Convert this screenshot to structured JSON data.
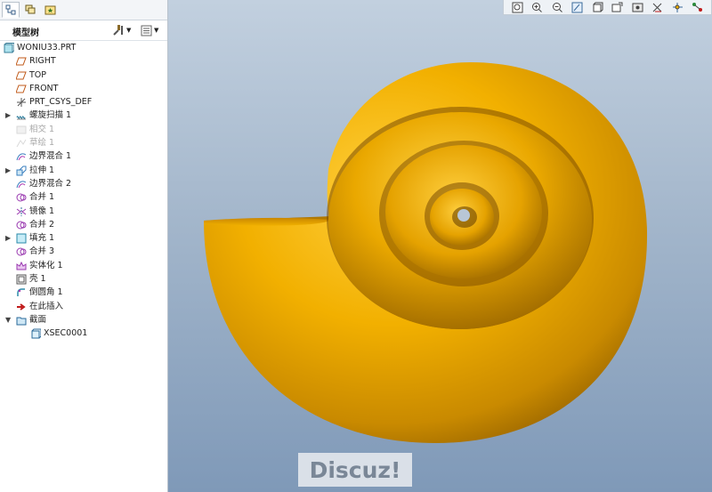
{
  "panel_tabs": [
    "model-tree-tab-icon",
    "layers-tab-icon",
    "favorites-tab-icon"
  ],
  "tree": {
    "title": "模型树",
    "items": [
      {
        "label": "WONIU33.PRT",
        "icon": "part-icon",
        "level": 0,
        "expand": ""
      },
      {
        "label": "RIGHT",
        "icon": "datum-plane-icon",
        "level": 1,
        "expand": ""
      },
      {
        "label": "TOP",
        "icon": "datum-plane-icon",
        "level": 1,
        "expand": ""
      },
      {
        "label": "FRONT",
        "icon": "datum-plane-icon",
        "level": 1,
        "expand": ""
      },
      {
        "label": "PRT_CSYS_DEF",
        "icon": "csys-icon",
        "level": 1,
        "expand": ""
      },
      {
        "label": "螺旋扫描 1",
        "icon": "helical-sweep-icon",
        "level": 1,
        "expand": "▶"
      },
      {
        "label": "相交 1",
        "icon": "intersect-icon",
        "level": 1,
        "expand": "",
        "dim": true
      },
      {
        "label": "草绘 1",
        "icon": "sketch-icon",
        "level": 1,
        "expand": "",
        "dim": true
      },
      {
        "label": "边界混合 1",
        "icon": "boundary-blend-icon",
        "level": 1,
        "expand": ""
      },
      {
        "label": "拉伸 1",
        "icon": "extrude-icon",
        "level": 1,
        "expand": "▶"
      },
      {
        "label": "边界混合 2",
        "icon": "boundary-blend-icon",
        "level": 1,
        "expand": ""
      },
      {
        "label": "合并 1",
        "icon": "merge-icon",
        "level": 1,
        "expand": ""
      },
      {
        "label": "镜像 1",
        "icon": "mirror-icon",
        "level": 1,
        "expand": ""
      },
      {
        "label": "合并 2",
        "icon": "merge-icon",
        "level": 1,
        "expand": ""
      },
      {
        "label": "填充 1",
        "icon": "fill-icon",
        "level": 1,
        "expand": "▶"
      },
      {
        "label": "合并 3",
        "icon": "merge-icon",
        "level": 1,
        "expand": ""
      },
      {
        "label": "实体化 1",
        "icon": "solidify-icon",
        "level": 1,
        "expand": ""
      },
      {
        "label": "壳 1",
        "icon": "shell-icon",
        "level": 1,
        "expand": ""
      },
      {
        "label": "倒圆角 1",
        "icon": "round-icon",
        "level": 1,
        "expand": ""
      },
      {
        "label": "在此插入",
        "icon": "insert-here-arrow-icon",
        "level": 1,
        "expand": ""
      },
      {
        "label": "截面",
        "icon": "section-folder-icon",
        "level": 1,
        "expand": "▼"
      },
      {
        "label": "XSEC0001",
        "icon": "xsec-icon",
        "level": 2,
        "expand": ""
      }
    ]
  },
  "view_toolbar": [
    "refit-icon",
    "zoom-in-icon",
    "zoom-out-icon",
    "repaint-icon",
    "display-style-icon",
    "saved-views-icon",
    "view-manager-icon",
    "datum-display-icon",
    "spin-center-icon",
    "annotation-display-icon"
  ],
  "watermark": "Discuz!",
  "colors": {
    "shell_gold": "#e0a000",
    "viewport_top": "#c2d0df",
    "viewport_bottom": "#7f99b8"
  }
}
